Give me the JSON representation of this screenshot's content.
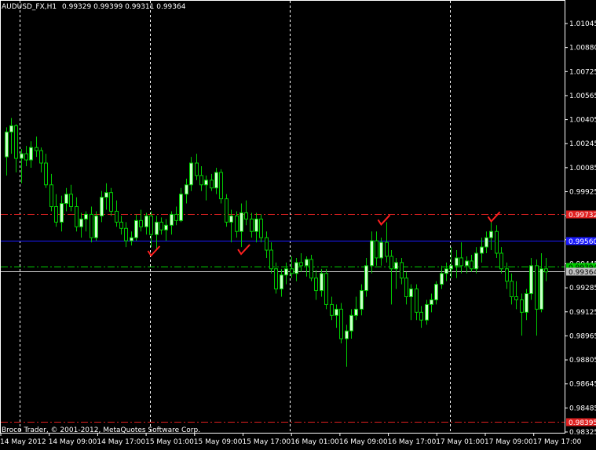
{
  "header": {
    "symbol_label": "AUDUSD_FX,H1",
    "ohlc": "0.99329 0.99399 0.99311 0.99364"
  },
  "footer": {
    "copyright": "Broco Trader, © 2001-2012, MetaQuotes Software Corp."
  },
  "colors": {
    "background": "#000000",
    "frame": "#ffffff",
    "bull_candle": "#ccffcc",
    "bear_candle": "#000000",
    "wick": "#00cc00",
    "red_line": "#e02020",
    "blue_line": "#1a1aff",
    "green_line": "#00cc00",
    "grey_line": "#c0c0c0",
    "check": "#ff2020"
  },
  "chart_data": {
    "type": "candlestick",
    "ylim": [
      0.98325,
      1.01104
    ],
    "y_ticks": [
      "1.01045",
      "1.00880",
      "1.00725",
      "1.00565",
      "1.00405",
      "1.00245",
      "1.00085",
      "0.99925",
      "0.99765",
      "0.99600",
      "0.99445",
      "0.99285",
      "0.99125",
      "0.98965",
      "0.98805",
      "0.98645",
      "0.98485",
      "0.98325"
    ],
    "x_ticks": [
      "14 May 2012",
      "14 May 09:00",
      "14 May 17:00",
      "15 May 01:00",
      "15 May 09:00",
      "15 May 17:00",
      "16 May 01:00",
      "16 May 09:00",
      "16 May 17:00",
      "17 May 01:00",
      "17 May 09:00",
      "17 May 17:00"
    ],
    "vertical_separators": [
      2.8,
      28.8,
      56.8,
      88.8
    ],
    "horizontal_levels": [
      {
        "price": 0.99732,
        "style": "dash-dot",
        "color": "#e02020",
        "label": "0.99732"
      },
      {
        "price": 0.9956,
        "style": "solid",
        "color": "#1a1aff",
        "label": "0.99560"
      },
      {
        "price": 0.99394,
        "style": "dash-dot",
        "color": "#00cc00",
        "label": "0.99394"
      },
      {
        "price": 0.99364,
        "style": "solid",
        "color": "#c0c0c0",
        "label": "0.99364"
      },
      {
        "price": 0.98395,
        "style": "dash-dot",
        "color": "#e02020",
        "label": "0.98395"
      }
    ],
    "checkmarks": [
      {
        "index": 29.5,
        "price": 0.9948
      },
      {
        "index": 47.5,
        "price": 0.9949
      },
      {
        "index": 75.5,
        "price": 0.9968
      },
      {
        "index": 97.5,
        "price": 0.997
      }
    ],
    "candles": [
      {
        "o": 1.001,
        "h": 1.0029,
        "l": 0.9998,
        "c": 1.0026
      },
      {
        "o": 1.0026,
        "h": 1.0035,
        "l": 1.0012,
        "c": 1.003
      },
      {
        "o": 1.003,
        "h": 1.0031,
        "l": 1.0,
        "c": 1.0009
      },
      {
        "o": 1.0009,
        "h": 1.0015,
        "l": 0.9993,
        "c": 1.0012
      },
      {
        "o": 1.0012,
        "h": 1.0017,
        "l": 1.0004,
        "c": 1.0008
      },
      {
        "o": 1.0008,
        "h": 1.002,
        "l": 1.0003,
        "c": 1.0016
      },
      {
        "o": 1.0016,
        "h": 1.0023,
        "l": 1.001,
        "c": 1.0014
      },
      {
        "o": 1.0014,
        "h": 1.0016,
        "l": 1.0,
        "c": 1.0006
      },
      {
        "o": 1.0006,
        "h": 1.0012,
        "l": 0.999,
        "c": 0.9992
      },
      {
        "o": 0.9992,
        "h": 0.9999,
        "l": 0.9975,
        "c": 0.9978
      },
      {
        "o": 0.9978,
        "h": 0.9986,
        "l": 0.9965,
        "c": 0.9968
      },
      {
        "o": 0.9968,
        "h": 0.9985,
        "l": 0.9962,
        "c": 0.998
      },
      {
        "o": 0.998,
        "h": 0.999,
        "l": 0.9975,
        "c": 0.9986
      },
      {
        "o": 0.9986,
        "h": 0.9992,
        "l": 0.9975,
        "c": 0.9978
      },
      {
        "o": 0.9978,
        "h": 0.9984,
        "l": 0.9962,
        "c": 0.9965
      },
      {
        "o": 0.9965,
        "h": 0.9974,
        "l": 0.9958,
        "c": 0.997
      },
      {
        "o": 0.997,
        "h": 0.9975,
        "l": 0.9962,
        "c": 0.9973
      },
      {
        "o": 0.9973,
        "h": 0.9978,
        "l": 0.9955,
        "c": 0.9958
      },
      {
        "o": 0.9958,
        "h": 0.9975,
        "l": 0.9956,
        "c": 0.9972
      },
      {
        "o": 0.9972,
        "h": 0.9988,
        "l": 0.9968,
        "c": 0.9984
      },
      {
        "o": 0.9984,
        "h": 0.9993,
        "l": 0.9976,
        "c": 0.9987
      },
      {
        "o": 0.9987,
        "h": 0.999,
        "l": 0.9972,
        "c": 0.9975
      },
      {
        "o": 0.9975,
        "h": 0.9982,
        "l": 0.9965,
        "c": 0.9968
      },
      {
        "o": 0.9968,
        "h": 0.9972,
        "l": 0.996,
        "c": 0.9964
      },
      {
        "o": 0.9964,
        "h": 0.9968,
        "l": 0.9952,
        "c": 0.9956
      },
      {
        "o": 0.9956,
        "h": 0.9962,
        "l": 0.9953,
        "c": 0.9958
      },
      {
        "o": 0.9958,
        "h": 0.9973,
        "l": 0.9956,
        "c": 0.9969
      },
      {
        "o": 0.9969,
        "h": 0.9976,
        "l": 0.9962,
        "c": 0.9965
      },
      {
        "o": 0.9965,
        "h": 0.9974,
        "l": 0.996,
        "c": 0.9972
      },
      {
        "o": 0.9972,
        "h": 0.9975,
        "l": 0.9952,
        "c": 0.996
      },
      {
        "o": 0.996,
        "h": 0.9972,
        "l": 0.995,
        "c": 0.9968
      },
      {
        "o": 0.9968,
        "h": 0.9971,
        "l": 0.996,
        "c": 0.9963
      },
      {
        "o": 0.9963,
        "h": 0.997,
        "l": 0.9956,
        "c": 0.9966
      },
      {
        "o": 0.9966,
        "h": 0.9975,
        "l": 0.996,
        "c": 0.9973
      },
      {
        "o": 0.9973,
        "h": 0.9978,
        "l": 0.9966,
        "c": 0.9969
      },
      {
        "o": 0.9969,
        "h": 0.999,
        "l": 0.9968,
        "c": 0.9986
      },
      {
        "o": 0.9986,
        "h": 0.9996,
        "l": 0.998,
        "c": 0.9992
      },
      {
        "o": 0.9992,
        "h": 1.001,
        "l": 0.9988,
        "c": 1.0006
      },
      {
        "o": 1.0006,
        "h": 1.0012,
        "l": 0.9995,
        "c": 0.9998
      },
      {
        "o": 0.9998,
        "h": 1.0004,
        "l": 0.9988,
        "c": 0.9992
      },
      {
        "o": 0.9992,
        "h": 0.9998,
        "l": 0.9982,
        "c": 0.9995
      },
      {
        "o": 0.9995,
        "h": 0.9999,
        "l": 0.9988,
        "c": 0.999
      },
      {
        "o": 0.999,
        "h": 1.0003,
        "l": 0.9986,
        "c": 1.0
      },
      {
        "o": 1.0,
        "h": 1.0002,
        "l": 0.998,
        "c": 0.9983
      },
      {
        "o": 0.9983,
        "h": 0.9986,
        "l": 0.9965,
        "c": 0.9968
      },
      {
        "o": 0.9968,
        "h": 0.9976,
        "l": 0.9955,
        "c": 0.9972
      },
      {
        "o": 0.9972,
        "h": 0.9975,
        "l": 0.9958,
        "c": 0.9962
      },
      {
        "o": 0.9962,
        "h": 0.998,
        "l": 0.9952,
        "c": 0.9974
      },
      {
        "o": 0.9974,
        "h": 0.9982,
        "l": 0.9966,
        "c": 0.997
      },
      {
        "o": 0.997,
        "h": 0.9974,
        "l": 0.9958,
        "c": 0.9962
      },
      {
        "o": 0.9962,
        "h": 0.9974,
        "l": 0.9955,
        "c": 0.997
      },
      {
        "o": 0.997,
        "h": 0.9973,
        "l": 0.9955,
        "c": 0.9958
      },
      {
        "o": 0.9958,
        "h": 0.9962,
        "l": 0.9945,
        "c": 0.995
      },
      {
        "o": 0.995,
        "h": 0.9955,
        "l": 0.9935,
        "c": 0.9938
      },
      {
        "o": 0.9938,
        "h": 0.9942,
        "l": 0.9922,
        "c": 0.9925
      },
      {
        "o": 0.9925,
        "h": 0.9938,
        "l": 0.992,
        "c": 0.9934
      },
      {
        "o": 0.9934,
        "h": 0.9942,
        "l": 0.9928,
        "c": 0.9938
      },
      {
        "o": 0.9938,
        "h": 0.9946,
        "l": 0.9932,
        "c": 0.9935
      },
      {
        "o": 0.9935,
        "h": 0.9945,
        "l": 0.993,
        "c": 0.9942
      },
      {
        "o": 0.9942,
        "h": 0.9948,
        "l": 0.9936,
        "c": 0.994
      },
      {
        "o": 0.994,
        "h": 0.9946,
        "l": 0.9933,
        "c": 0.9944
      },
      {
        "o": 0.9944,
        "h": 0.9947,
        "l": 0.993,
        "c": 0.9932
      },
      {
        "o": 0.9932,
        "h": 0.9937,
        "l": 0.9918,
        "c": 0.9924
      },
      {
        "o": 0.9924,
        "h": 0.9938,
        "l": 0.992,
        "c": 0.9935
      },
      {
        "o": 0.9935,
        "h": 0.9938,
        "l": 0.9912,
        "c": 0.9915
      },
      {
        "o": 0.9915,
        "h": 0.992,
        "l": 0.9905,
        "c": 0.9908
      },
      {
        "o": 0.9908,
        "h": 0.9915,
        "l": 0.99,
        "c": 0.9912
      },
      {
        "o": 0.9912,
        "h": 0.9916,
        "l": 0.989,
        "c": 0.9893
      },
      {
        "o": 0.9893,
        "h": 0.9902,
        "l": 0.9875,
        "c": 0.9898
      },
      {
        "o": 0.9898,
        "h": 0.9912,
        "l": 0.9893,
        "c": 0.9908
      },
      {
        "o": 0.9908,
        "h": 0.992,
        "l": 0.9905,
        "c": 0.9912
      },
      {
        "o": 0.9912,
        "h": 0.9928,
        "l": 0.9908,
        "c": 0.9924
      },
      {
        "o": 0.9924,
        "h": 0.9945,
        "l": 0.992,
        "c": 0.994
      },
      {
        "o": 0.994,
        "h": 0.9962,
        "l": 0.9935,
        "c": 0.9956
      },
      {
        "o": 0.9956,
        "h": 0.9962,
        "l": 0.994,
        "c": 0.9945
      },
      {
        "o": 0.9945,
        "h": 0.9958,
        "l": 0.994,
        "c": 0.9955
      },
      {
        "o": 0.9955,
        "h": 0.9968,
        "l": 0.9942,
        "c": 0.9946
      },
      {
        "o": 0.9946,
        "h": 0.995,
        "l": 0.9915,
        "c": 0.9938
      },
      {
        "o": 0.9938,
        "h": 0.9945,
        "l": 0.9925,
        "c": 0.9942
      },
      {
        "o": 0.9942,
        "h": 0.9945,
        "l": 0.9928,
        "c": 0.9932
      },
      {
        "o": 0.9932,
        "h": 0.9936,
        "l": 0.9915,
        "c": 0.992
      },
      {
        "o": 0.992,
        "h": 0.9928,
        "l": 0.9905,
        "c": 0.9925
      },
      {
        "o": 0.9925,
        "h": 0.9928,
        "l": 0.9905,
        "c": 0.991
      },
      {
        "o": 0.991,
        "h": 0.9914,
        "l": 0.99,
        "c": 0.9905
      },
      {
        "o": 0.9905,
        "h": 0.9918,
        "l": 0.9902,
        "c": 0.9915
      },
      {
        "o": 0.9915,
        "h": 0.9922,
        "l": 0.991,
        "c": 0.9918
      },
      {
        "o": 0.9918,
        "h": 0.993,
        "l": 0.9915,
        "c": 0.9928
      },
      {
        "o": 0.9928,
        "h": 0.994,
        "l": 0.9925,
        "c": 0.9935
      },
      {
        "o": 0.9935,
        "h": 0.9942,
        "l": 0.993,
        "c": 0.9938
      },
      {
        "o": 0.9938,
        "h": 0.9952,
        "l": 0.9932,
        "c": 0.994
      },
      {
        "o": 0.994,
        "h": 0.995,
        "l": 0.9932,
        "c": 0.9945
      },
      {
        "o": 0.9945,
        "h": 0.9955,
        "l": 0.9935,
        "c": 0.994
      },
      {
        "o": 0.994,
        "h": 0.9946,
        "l": 0.9935,
        "c": 0.9943
      },
      {
        "o": 0.9943,
        "h": 0.9947,
        "l": 0.9936,
        "c": 0.9938
      },
      {
        "o": 0.9938,
        "h": 0.9952,
        "l": 0.9935,
        "c": 0.9948
      },
      {
        "o": 0.9948,
        "h": 0.9958,
        "l": 0.9942,
        "c": 0.9952
      },
      {
        "o": 0.9952,
        "h": 0.9962,
        "l": 0.9948,
        "c": 0.9958
      },
      {
        "o": 0.9958,
        "h": 0.9968,
        "l": 0.995,
        "c": 0.9962
      },
      {
        "o": 0.9962,
        "h": 0.9966,
        "l": 0.9945,
        "c": 0.9948
      },
      {
        "o": 0.9948,
        "h": 0.9952,
        "l": 0.9935,
        "c": 0.9938
      },
      {
        "o": 0.9938,
        "h": 0.9942,
        "l": 0.9925,
        "c": 0.993
      },
      {
        "o": 0.993,
        "h": 0.9935,
        "l": 0.9915,
        "c": 0.992
      },
      {
        "o": 0.992,
        "h": 0.993,
        "l": 0.9912,
        "c": 0.9918
      },
      {
        "o": 0.9918,
        "h": 0.9922,
        "l": 0.9895,
        "c": 0.991
      },
      {
        "o": 0.991,
        "h": 0.9925,
        "l": 0.9905,
        "c": 0.9922
      },
      {
        "o": 0.9922,
        "h": 0.9945,
        "l": 0.9918,
        "c": 0.994
      },
      {
        "o": 0.994,
        "h": 0.9944,
        "l": 0.9895,
        "c": 0.9912
      },
      {
        "o": 0.9912,
        "h": 0.9948,
        "l": 0.991,
        "c": 0.9938
      },
      {
        "o": 0.9938,
        "h": 0.9945,
        "l": 0.993,
        "c": 0.9936
      }
    ]
  }
}
